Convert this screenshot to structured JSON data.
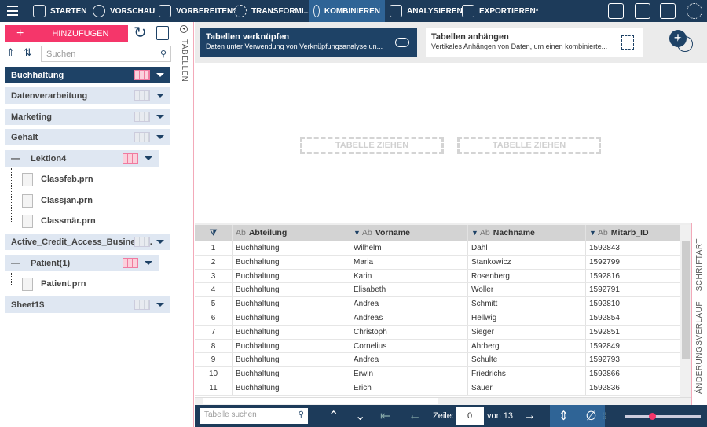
{
  "topbar": {
    "tabs": [
      {
        "label": "STARTEN",
        "icon": "cube-icon"
      },
      {
        "label": "VORSCHAU",
        "icon": "eye-icon"
      },
      {
        "label": "VORBEREITEN*",
        "icon": "columns-icon"
      },
      {
        "label": "TRANSFORMI...",
        "icon": "cycle-icon"
      },
      {
        "label": "KOMBINIEREN",
        "icon": "venn-icon"
      },
      {
        "label": "ANALYSIEREN",
        "icon": "clipboard-icon"
      },
      {
        "label": "EXPORTIEREN*",
        "icon": "export-icon"
      }
    ],
    "active": "KOMBINIEREN"
  },
  "left": {
    "add_label": "HINZUFUGEN",
    "search_placeholder": "Suchen",
    "tables_label": "TABELLEN",
    "groups": [
      {
        "label": "Buchhaltung"
      },
      {
        "label": "Datenverarbeitung"
      },
      {
        "label": "Marketing"
      },
      {
        "label": "Gehalt"
      },
      {
        "label": "Lektion4",
        "children": [
          "Classfeb.prn",
          "Classjan.prn",
          "Classmär.prn"
        ]
      },
      {
        "label": "Active_Credit_Access_Business..."
      },
      {
        "label": "Patient(1)",
        "children": [
          "Patient.prn"
        ]
      },
      {
        "label": "Sheet1$"
      }
    ]
  },
  "combine": {
    "join": {
      "title": "Tabellen verknüpfen",
      "desc": "Daten unter Verwendung von Verknüpfungsanalyse un..."
    },
    "append": {
      "title": "Tabellen anhängen",
      "desc": "Vertikales Anhängen von Daten, um einen kombinierte..."
    },
    "drop1": "TABELLE ZIEHEN",
    "drop2": "TABELLE ZIEHEN"
  },
  "grid": {
    "type_prefix": "Ab",
    "columns": [
      "Abteilung",
      "Vorname",
      "Nachname",
      "Mitarb_ID"
    ],
    "rows": [
      [
        "1",
        "Buchhaltung",
        "Wilhelm",
        "Dahl",
        "1592843"
      ],
      [
        "2",
        "Buchhaltung",
        "Maria",
        "Stankowicz",
        "1592799"
      ],
      [
        "3",
        "Buchhaltung",
        "Karin",
        "Rosenberg",
        "1592816"
      ],
      [
        "4",
        "Buchhaltung",
        "Elisabeth",
        "Woller",
        "1592791"
      ],
      [
        "5",
        "Buchhaltung",
        "Andrea",
        "Schmitt",
        "1592810"
      ],
      [
        "6",
        "Buchhaltung",
        "Andreas",
        "Hellwig",
        "1592854"
      ],
      [
        "7",
        "Buchhaltung",
        "Christoph",
        "Sieger",
        "1592851"
      ],
      [
        "8",
        "Buchhaltung",
        "Cornelius",
        "Ahrberg",
        "1592849"
      ],
      [
        "9",
        "Buchhaltung",
        "Andrea",
        "Schulte",
        "1592793"
      ],
      [
        "10",
        "Buchhaltung",
        "Erwin",
        "Friedrichs",
        "1592866"
      ],
      [
        "11",
        "Buchhaltung",
        "Erich",
        "Sauer",
        "1592836"
      ]
    ]
  },
  "right": {
    "font_label": "SCHRIFTART",
    "history_label": "ÄNDERUNGSVERLAUF"
  },
  "bottom": {
    "search_placeholder": "Tabelle suchen",
    "row_label": "Zeile:",
    "row_value": "0",
    "of_label": "von 13",
    "zoom_fraction": 0.35
  }
}
